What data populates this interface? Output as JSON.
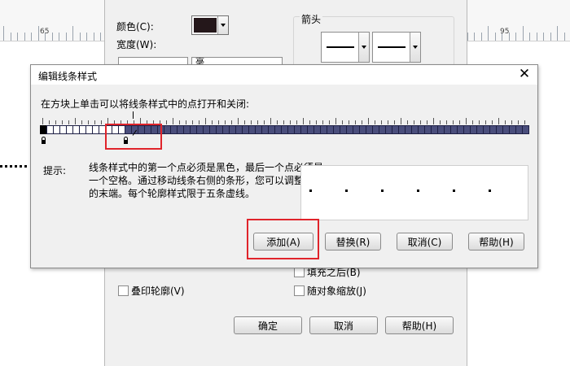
{
  "ruler": {
    "labels": [
      "65",
      "95"
    ]
  },
  "properties_panel": {
    "color_label": "颜色(C):",
    "color_value": "#24171a",
    "width_label": "宽度(W):",
    "width_partial": "毫",
    "arrows_label": "箭头",
    "fill_behind_label": "填充之后(B)",
    "overprint_label": "叠印轮廓(V)",
    "scale_with_object_label": "随对象缩放(J)",
    "ok_label": "确定",
    "cancel_label": "取消",
    "help_label": "帮助(H)"
  },
  "dialog": {
    "title": "编辑线条样式",
    "close_glyph": "✕",
    "instruction": "在方块上单击可以将线条样式中的点打开和关闭:",
    "hint_label": "提示:",
    "hint_text": "线条样式中的第一个点必须是黑色，最后一个点必须是一个空格。通过移动线条右侧的条形，您可以调整样式的末端。每个轮廓样式限于五条虚线。",
    "buttons": {
      "add": "添加(A)",
      "replace": "替换(R)",
      "cancel": "取消(C)",
      "help": "帮助(H)"
    },
    "pattern": {
      "total_cells": 75,
      "active_cells": 13,
      "first_cell_black": true
    }
  },
  "colors": {
    "highlight": "#e0242b",
    "dash_fill": "#4a4e7c",
    "dialog_bg": "#f0f0f0"
  }
}
